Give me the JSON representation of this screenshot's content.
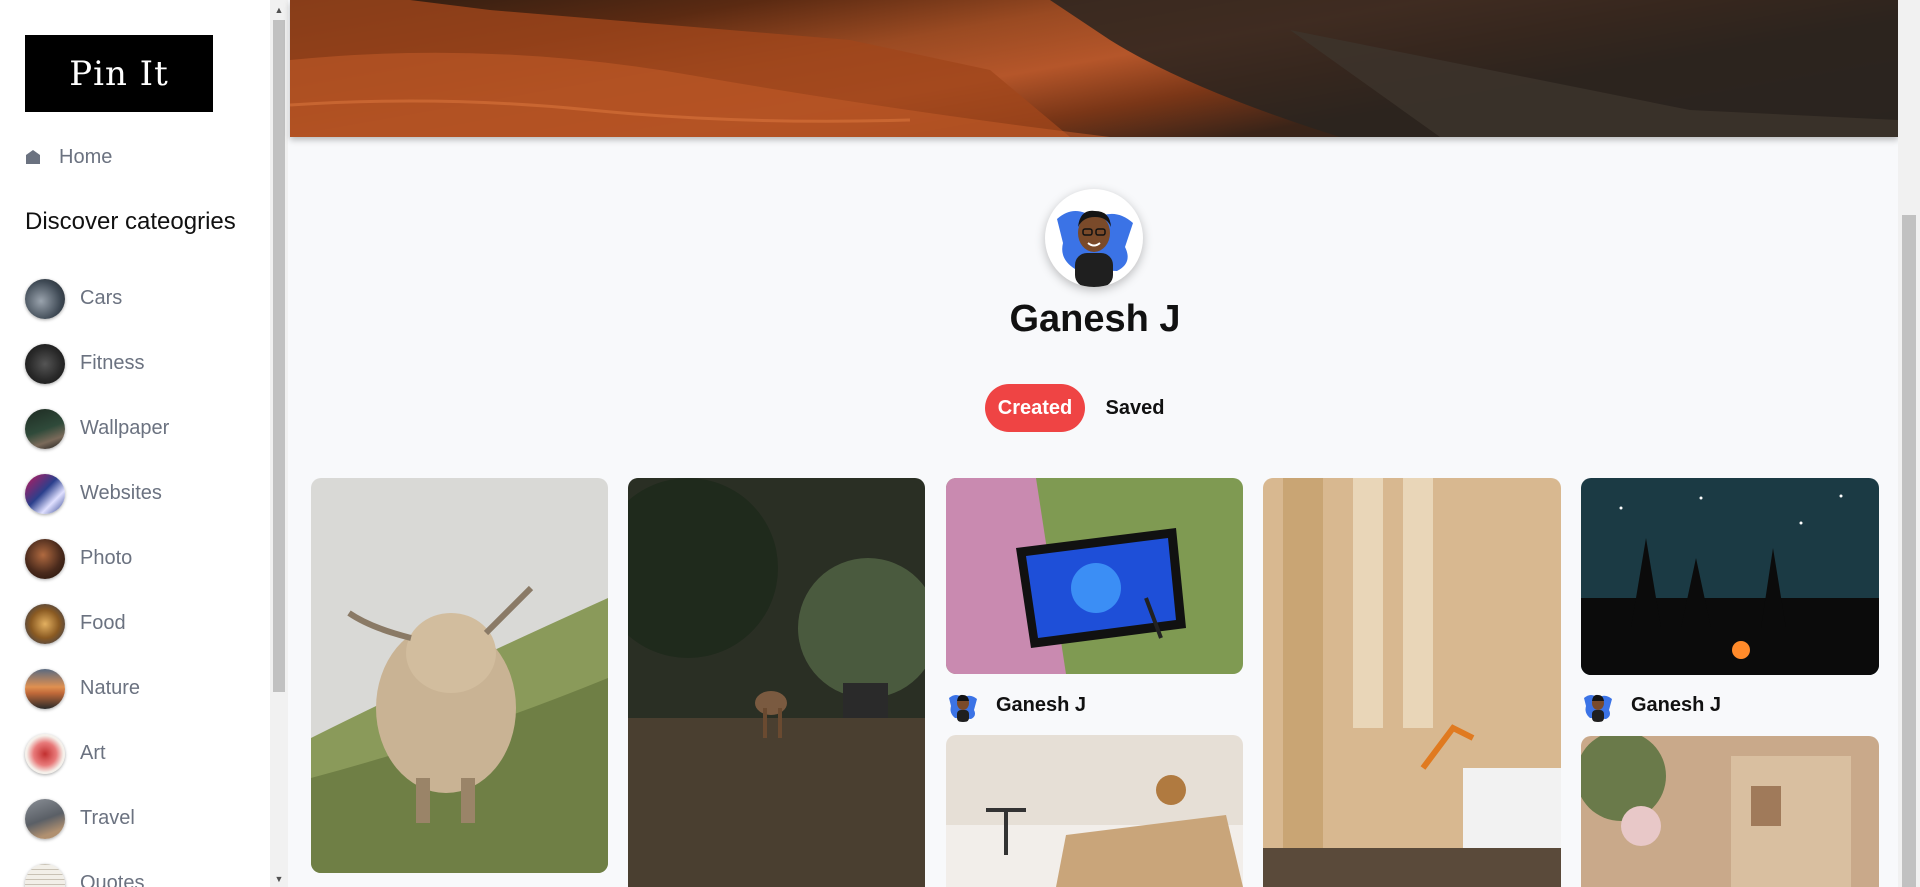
{
  "app": {
    "logo_text": "Pin It"
  },
  "sidebar": {
    "home_label": "Home",
    "discover_title": "Discover cateogries",
    "categories": [
      {
        "label": "Cars",
        "color": "#3f4a55"
      },
      {
        "label": "Fitness",
        "color": "#2a2a2a"
      },
      {
        "label": "Wallpaper",
        "color": "#2f4a3a"
      },
      {
        "label": "Websites",
        "color": "#2b3f8c"
      },
      {
        "label": "Photo",
        "color": "#4a2a1c"
      },
      {
        "label": "Food",
        "color": "#8a5a22"
      },
      {
        "label": "Nature",
        "color": "#c26a3a"
      },
      {
        "label": "Art",
        "color": "#c23030"
      },
      {
        "label": "Travel",
        "color": "#5a5f66"
      },
      {
        "label": "Quotes",
        "color": "#e8e4dc"
      }
    ]
  },
  "profile": {
    "name": "Ganesh J",
    "tabs": {
      "created": "Created",
      "saved": "Saved"
    },
    "active_tab": "Created",
    "accent_color": "#ef4444"
  },
  "pins": [
    {
      "subject": "highland-cow"
    },
    {
      "subject": "deer-in-forest"
    },
    {
      "subject": "tablet-stylus",
      "author": "Ganesh J"
    },
    {
      "subject": "santorini"
    },
    {
      "subject": "office-desk"
    },
    {
      "subject": "night-sky-campfire",
      "author": "Ganesh J"
    },
    {
      "subject": "street-flowers"
    }
  ]
}
